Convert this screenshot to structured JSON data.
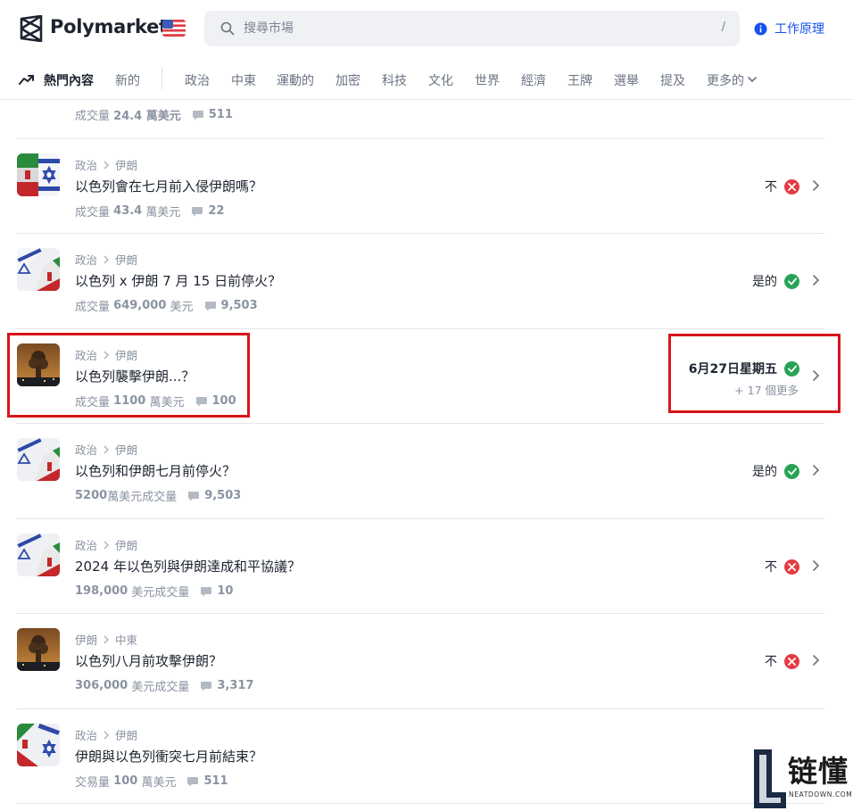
{
  "header": {
    "brand": "Polymarket",
    "search_placeholder": "搜尋市場",
    "search_shortcut": "/",
    "how_it_works": "工作原理"
  },
  "nav": {
    "trending": "熱門內容",
    "new": "新的",
    "categories": [
      "政治",
      "中東",
      "運動的",
      "加密",
      "科技",
      "文化",
      "世界",
      "經濟",
      "王牌",
      "選舉",
      "提及"
    ],
    "more": "更多的"
  },
  "partial_row": {
    "volume": "成交量",
    "volume_amount": "24.4 萬美元",
    "comments": "511"
  },
  "rows": [
    {
      "crumb1": "政治",
      "crumb2": "伊朗",
      "question": "以色列會在七月前入侵伊朗嗎？",
      "vol_prefix": "成交量",
      "vol_value": "43.4",
      "vol_suffix": "萬美元",
      "comments": "22",
      "result": "不",
      "result_type": "no"
    },
    {
      "crumb1": "政治",
      "crumb2": "伊朗",
      "question": "以色列 x 伊朗 7 月 15 日前停火？",
      "vol_prefix": "成交量",
      "vol_value": "649,000",
      "vol_suffix": "美元",
      "comments": "9,503",
      "result": "是的",
      "result_type": "yes"
    },
    {
      "crumb1": "政治",
      "crumb2": "伊朗",
      "question": "以色列襲擊伊朗...？",
      "vol_prefix": "成交量",
      "vol_value": "1100",
      "vol_suffix": "萬美元",
      "comments": "100",
      "result": "6月27日星期五",
      "result_type": "yes",
      "more": "+ 17 個更多"
    },
    {
      "crumb1": "政治",
      "crumb2": "伊朗",
      "question": "以色列和伊朗七月前停火？",
      "vol_prefix": "",
      "vol_value": "5200",
      "vol_suffix": "萬美元成交量",
      "comments": "9,503",
      "result": "是的",
      "result_type": "yes"
    },
    {
      "crumb1": "政治",
      "crumb2": "伊朗",
      "question": "2024 年以色列與伊朗達成和平協議？",
      "vol_prefix": "",
      "vol_value": "198,000",
      "vol_suffix": "美元成交量",
      "comments": "10",
      "result": "不",
      "result_type": "no"
    },
    {
      "crumb1": "伊朗",
      "crumb2": "中東",
      "question": "以色列八月前攻擊伊朗？",
      "vol_prefix": "",
      "vol_value": "306,000",
      "vol_suffix": "美元成交量",
      "comments": "3,317",
      "result": "不",
      "result_type": "no"
    },
    {
      "crumb1": "政治",
      "crumb2": "伊朗",
      "question": "伊朗與以色列衝突七月前結束？",
      "vol_prefix": "交易量",
      "vol_value": "100",
      "vol_suffix": "萬美元",
      "comments": "511",
      "result": "",
      "result_type": ""
    }
  ],
  "watermark": {
    "text": "链懂",
    "sub": "NEATDOWN.COM"
  },
  "colors": {
    "accent": "#1652f0",
    "yes": "#28a355",
    "no": "#e23c43",
    "highlight": "#d71519"
  }
}
